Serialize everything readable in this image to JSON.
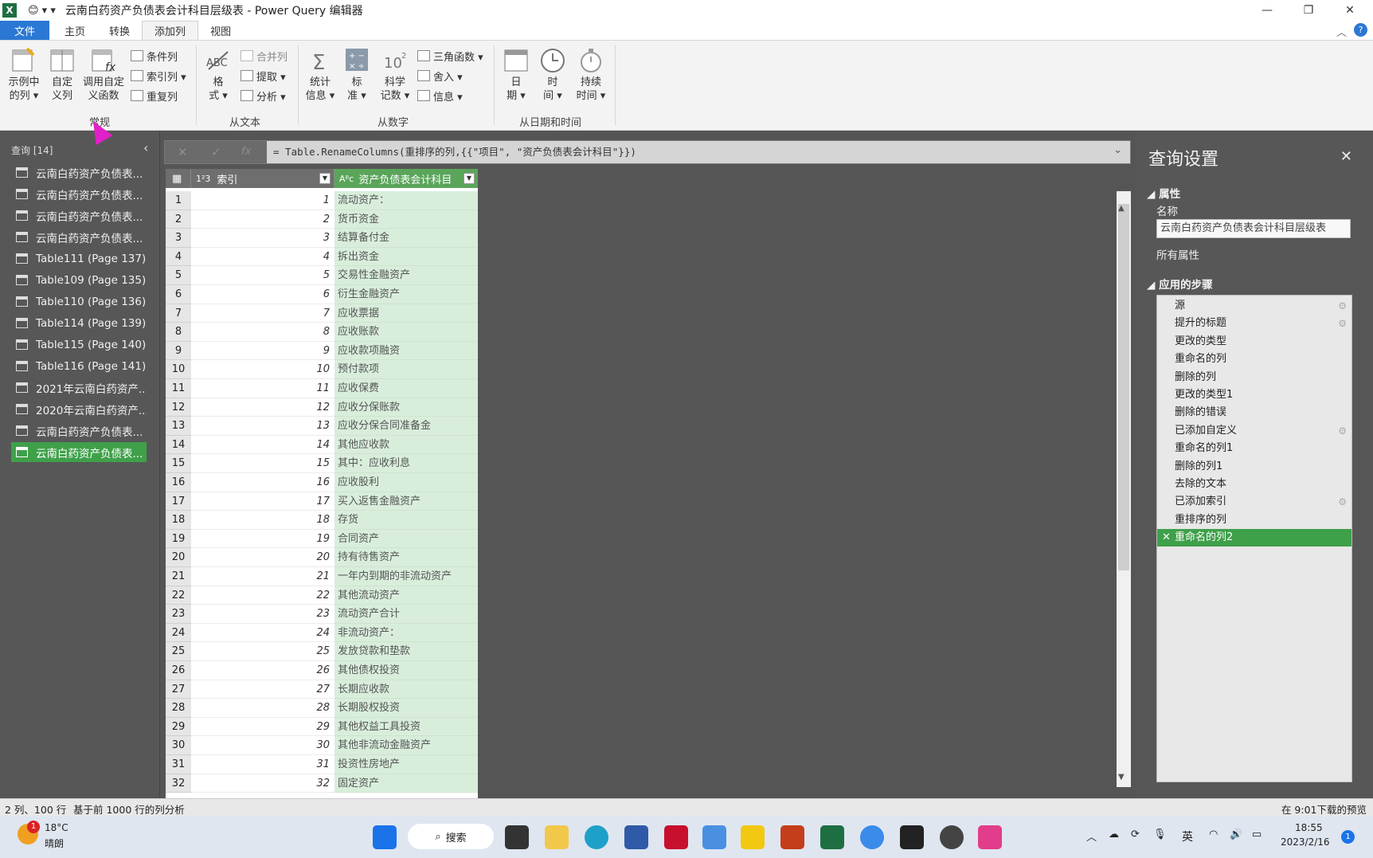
{
  "window": {
    "title": "云南白药资产负债表会计科目层级表 - Power Query 编辑器",
    "app_icon": "X",
    "quick_access": "😊 ▾ ▾",
    "minimize": "—",
    "restore": "❐",
    "close": "✕"
  },
  "menu": {
    "file": "文件",
    "tabs": [
      "主页",
      "转换",
      "添加列",
      "视图"
    ],
    "collapse": "︿",
    "help": "?"
  },
  "ribbon": {
    "general": {
      "example_col": "示例中\n的列 ▾",
      "custom_col": "自定\n义列",
      "invoke_func": "调用自定\n义函数",
      "cond_col": "条件列",
      "index_col": "索引列 ▾",
      "dup_col": "重复列",
      "label": "常规"
    },
    "from_text": {
      "format": "格\n式 ▾",
      "merge": "合并列",
      "extract": "提取 ▾",
      "parse": "分析 ▾",
      "label": "从文本"
    },
    "from_number": {
      "stats": "统计\n信息 ▾",
      "standard": "标\n准 ▾",
      "scientific": "科学\n记数 ▾",
      "trig": "三角函数 ▾",
      "rounding": "舍入 ▾",
      "info": "信息 ▾",
      "label": "从数字"
    },
    "from_datetime": {
      "date": "日\n期 ▾",
      "time": "时\n间 ▾",
      "duration": "持续\n时间 ▾",
      "label": "从日期和时间"
    }
  },
  "queries": {
    "header": "查询 [14]",
    "items": [
      "云南白药资产负债表...",
      "云南白药资产负债表...",
      "云南白药资产负债表...",
      "云南白药资产负债表...",
      "Table111 (Page 137)",
      "Table109 (Page 135)",
      "Table110 (Page 136)",
      "Table114 (Page 139)",
      "Table115 (Page 140)",
      "Table116 (Page 141)",
      "2021年云南白药资产...",
      "2020年云南白药资产...",
      "云南白药资产负债表...",
      "云南白药资产负债表..."
    ],
    "selected_index": 13
  },
  "formula": {
    "cancel": "✕",
    "confirm": "✓",
    "fx": "fx",
    "text": "= Table.RenameColumns(重排序的列,{{\"项目\", \"资产负债表会计科目\"}})",
    "expand": "⌄"
  },
  "grid": {
    "corner": "▦",
    "col1_type": "1²3",
    "col1_name": "索引",
    "col2_type": "Aᴮc",
    "col2_name": "资产负债表会计科目",
    "dropdown": "▼",
    "rows": [
      [
        "1",
        "1",
        "流动资产："
      ],
      [
        "2",
        "2",
        "货币资金"
      ],
      [
        "3",
        "3",
        "结算备付金"
      ],
      [
        "4",
        "4",
        "拆出资金"
      ],
      [
        "5",
        "5",
        "交易性金融资产"
      ],
      [
        "6",
        "6",
        "衍生金融资产"
      ],
      [
        "7",
        "7",
        "应收票据"
      ],
      [
        "8",
        "8",
        "应收账款"
      ],
      [
        "9",
        "9",
        "应收款项融资"
      ],
      [
        "10",
        "10",
        "预付款项"
      ],
      [
        "11",
        "11",
        "应收保费"
      ],
      [
        "12",
        "12",
        "应收分保账款"
      ],
      [
        "13",
        "13",
        "应收分保合同准备金"
      ],
      [
        "14",
        "14",
        "其他应收款"
      ],
      [
        "15",
        "15",
        "其中：应收利息"
      ],
      [
        "16",
        "16",
        "应收股利"
      ],
      [
        "17",
        "17",
        "买入返售金融资产"
      ],
      [
        "18",
        "18",
        "存货"
      ],
      [
        "19",
        "19",
        "合同资产"
      ],
      [
        "20",
        "20",
        "持有待售资产"
      ],
      [
        "21",
        "21",
        "一年内到期的非流动资产"
      ],
      [
        "22",
        "22",
        "其他流动资产"
      ],
      [
        "23",
        "23",
        "流动资产合计"
      ],
      [
        "24",
        "24",
        "非流动资产："
      ],
      [
        "25",
        "25",
        "发放贷款和垫款"
      ],
      [
        "26",
        "26",
        "其他债权投资"
      ],
      [
        "27",
        "27",
        "长期应收款"
      ],
      [
        "28",
        "28",
        "长期股权投资"
      ],
      [
        "29",
        "29",
        "其他权益工具投资"
      ],
      [
        "30",
        "30",
        "其他非流动金融资产"
      ],
      [
        "31",
        "31",
        "投资性房地产"
      ],
      [
        "32",
        "32",
        "固定资产"
      ]
    ]
  },
  "settings": {
    "title": "查询设置",
    "close": "✕",
    "properties": "◢ 属性",
    "name_label": "名称",
    "name_value": "云南白药资产负债表会计科目层级表",
    "all_props": "所有属性",
    "applied_steps": "◢ 应用的步骤",
    "steps": [
      "源",
      "提升的标题",
      "更改的类型",
      "重命名的列",
      "删除的列",
      "更改的类型1",
      "删除的错误",
      "已添加自定义",
      "重命名的列1",
      "删除的列1",
      "去除的文本",
      "已添加索引",
      "重排序的列",
      "重命名的列2"
    ],
    "gear_steps": [
      0,
      1,
      7,
      11
    ],
    "selected_step": 13,
    "gear": "⚙"
  },
  "status": {
    "left1": "2 列、100 行",
    "left2": "基于前 1000 行的列分析",
    "right": "在 9:01下载的预览"
  },
  "taskbar": {
    "weather_temp": "18°C",
    "weather_desc": "晴朗",
    "weather_badge": "1",
    "search": "搜索",
    "lang": "英",
    "time": "18:55",
    "date": "2023/2/16",
    "notif": "1"
  },
  "colors": {
    "accent_green": "#3fa04a",
    "file_blue": "#2b78d4"
  }
}
